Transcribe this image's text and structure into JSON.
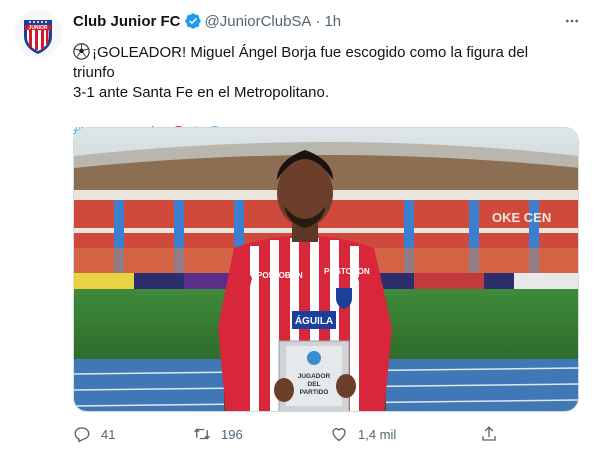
{
  "tweet": {
    "display_name": "Club Junior FC",
    "handle": "@JuniorClubSA",
    "separator": "·",
    "time": "1h",
    "text_line1": "¡GOLEADOR! Miguel Ángel Borja fue escogido como la figura del triunfo",
    "text_line2": "3-1 ante Santa Fe en el Metropolitano.",
    "hashtag": "#VamosJunior",
    "hashtag_emoji_colors": [
      "#e0233f",
      "#e6e6e6",
      "#55acee"
    ]
  },
  "media": {
    "sponsor_text": "POSTOBON",
    "jersey_text": "ÁGUILA",
    "trophy_line1": "JUGADOR",
    "trophy_line2": "DEL",
    "trophy_line3": "PARTIDO",
    "stand_text": "OKE CEN"
  },
  "actions": {
    "replies": "41",
    "retweets": "196",
    "likes": "1,4 mil"
  },
  "icons": [
    "club-crest-icon",
    "verified-badge-icon",
    "more-options-icon",
    "soccer-ball-icon",
    "reply-icon",
    "retweet-icon",
    "like-icon",
    "share-icon"
  ],
  "colors": {
    "accent": "#1d9bf0",
    "muted": "#536471",
    "text": "#0f1419"
  }
}
